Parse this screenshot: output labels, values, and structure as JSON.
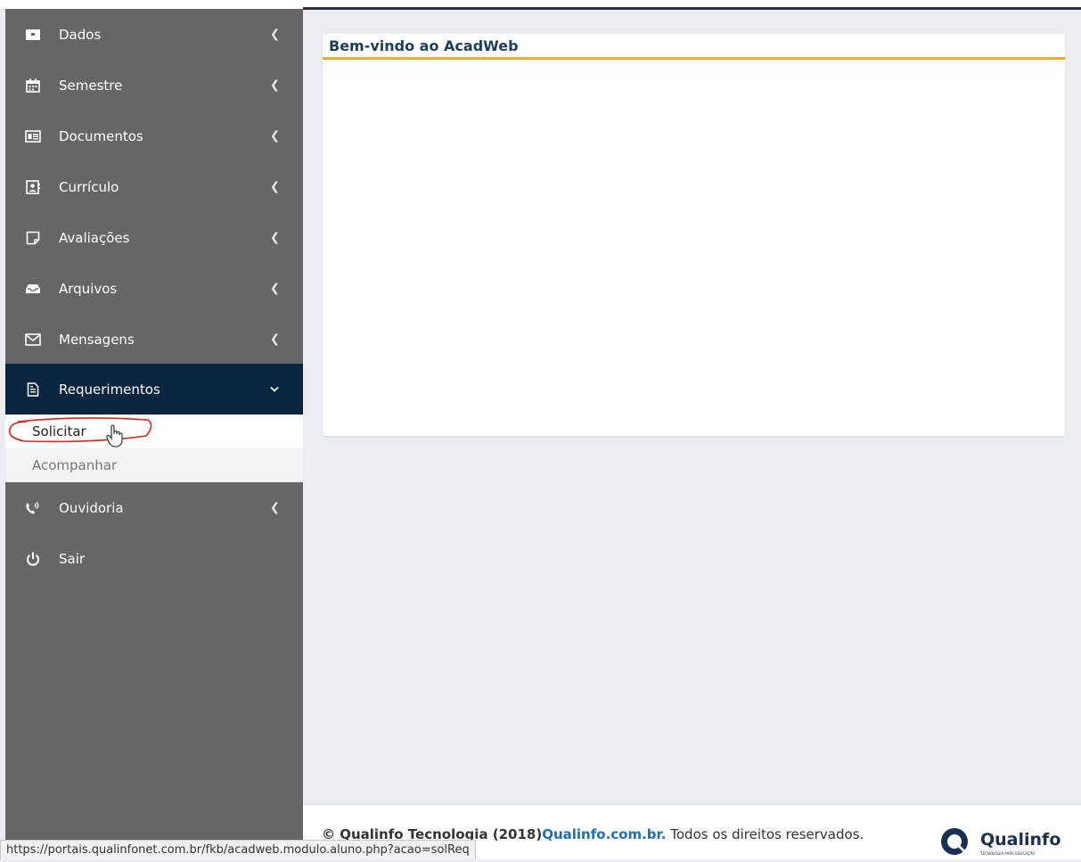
{
  "sidebar": {
    "items": [
      {
        "label": "Dados",
        "icon": "id-card-icon"
      },
      {
        "label": "Semestre",
        "icon": "calendar-icon"
      },
      {
        "label": "Documentos",
        "icon": "newspaper-icon"
      },
      {
        "label": "Currículo",
        "icon": "contact-card-icon"
      },
      {
        "label": "Avaliações",
        "icon": "note-icon"
      },
      {
        "label": "Arquivos",
        "icon": "inbox-icon"
      },
      {
        "label": "Mensagens",
        "icon": "envelope-icon"
      },
      {
        "label": "Requerimentos",
        "icon": "document-icon",
        "expanded": true
      },
      {
        "label": "Ouvidoria",
        "icon": "phone-volume-icon"
      },
      {
        "label": "Sair",
        "icon": "power-icon"
      }
    ],
    "submenu": [
      {
        "label": "Solicitar"
      },
      {
        "label": "Acompanhar"
      }
    ]
  },
  "main": {
    "panel_title": "Bem-vindo ao AcadWeb"
  },
  "footer": {
    "copyright": "© Qualinfo Tecnologia (2018)",
    "link": "Qualinfo.com.br.",
    "rights": " Todos os direitos reservados.",
    "logo_text": "Qualinfo",
    "logo_tagline": "TECNOLOGIA PARA EDUCAÇÃO"
  },
  "status_bar": {
    "url": "https://portais.qualinfonet.com.br/fkb/acadweb.modulo.aluno.php?acao=solReq"
  },
  "colors": {
    "sidebar_bg": "#666666",
    "active_bg": "#0b2640",
    "accent_rule": "#f0a92a",
    "title_color": "#1d3d5e",
    "link_color": "#1f6fb8",
    "annotation": "#e0201b"
  }
}
